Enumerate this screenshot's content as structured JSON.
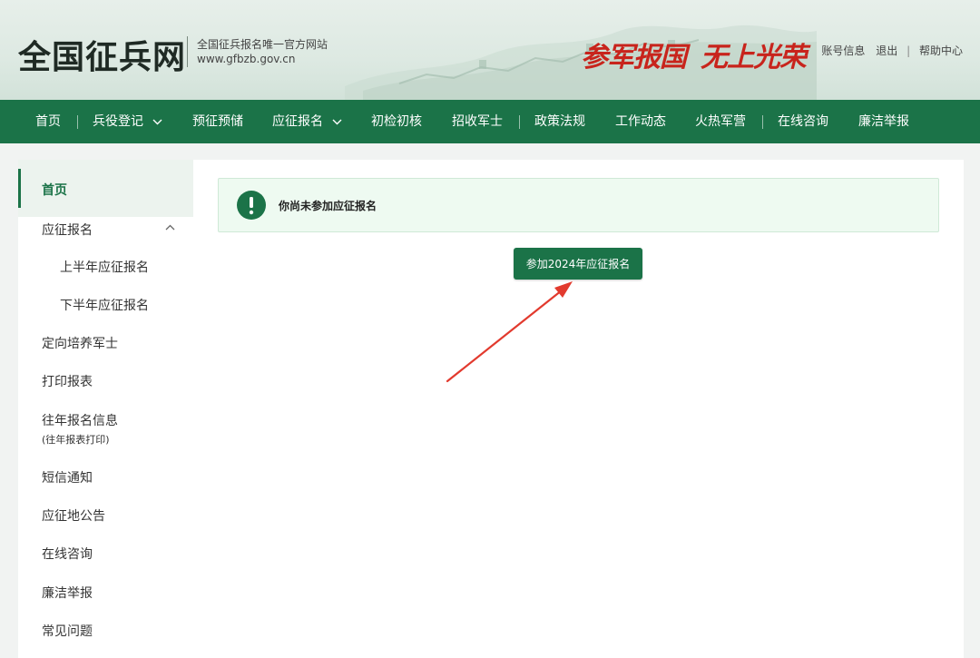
{
  "header": {
    "site_name": "全国征兵网",
    "tagline": "全国征兵报名唯一官方网站",
    "domain": "www.gfbzb.gov.cn",
    "slogan_left": "参军报国",
    "slogan_right": "无上光荣",
    "slogan_color": "#c8241c",
    "links": {
      "account": "账号信息",
      "logout": "退出",
      "help": "帮助中心"
    }
  },
  "nav": {
    "items": [
      "首页",
      "兵役登记",
      "预征预储",
      "应征报名",
      "初检初核",
      "招收军士",
      "政策法规",
      "工作动态",
      "火热军营",
      "在线咨询",
      "廉洁举报"
    ],
    "dropdown_items": [
      "兵役登记",
      "应征报名"
    ],
    "bg_color": "#1b7348"
  },
  "sidebar": {
    "items": [
      "首页",
      "应征报名",
      "上半年应征报名",
      "下半年应征报名",
      "定向培养军士",
      "打印报表",
      "往年报名信息",
      "短信通知",
      "应征地公告",
      "在线咨询",
      "廉洁举报",
      "常见问题"
    ],
    "item_note": "(往年报表打印)",
    "active": "首页",
    "expanded": "应征报名"
  },
  "main": {
    "alert_text": "你尚未参加应征报名",
    "alert_icon": "exclamation-circle-icon",
    "join_button": "参加2024年应征报名",
    "annotation": "red-arrow-pointing-to-join-button"
  },
  "colors": {
    "primary": "#1b7348",
    "alert_bg": "#eefaf1",
    "arrow": "#e23a2e"
  }
}
